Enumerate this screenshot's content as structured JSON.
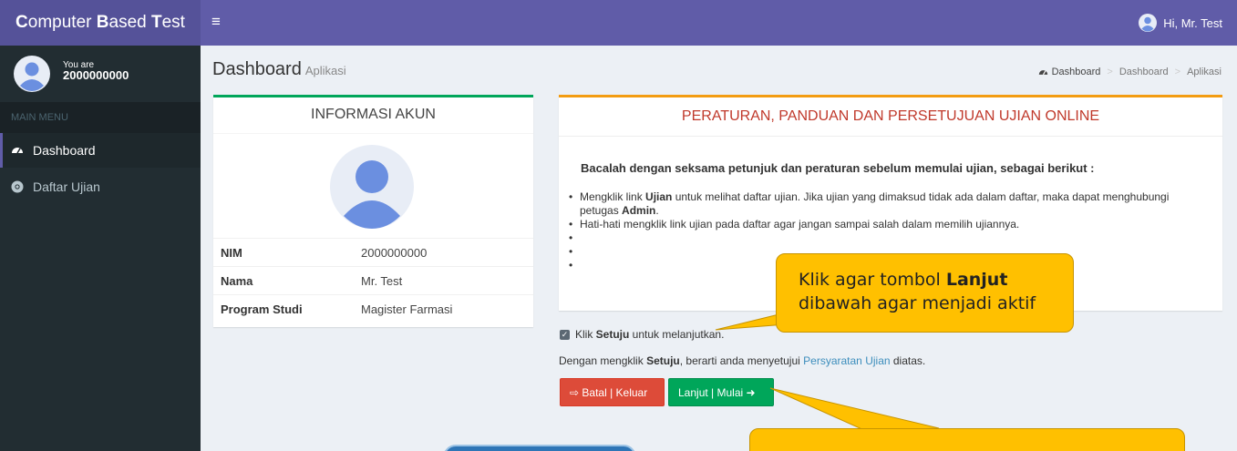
{
  "app": {
    "title_parts": [
      "C",
      "omputer ",
      "B",
      "ased ",
      "T",
      "est"
    ],
    "user_greeting": "Hi, Mr. Test"
  },
  "sidebar": {
    "you_are": "You are",
    "user_id": "2000000000",
    "menu_header": "MAIN MENU",
    "items": [
      {
        "label": "Dashboard",
        "icon": "dashboard-icon",
        "active": true
      },
      {
        "label": "Daftar Ujian",
        "icon": "chrome-icon",
        "active": false
      }
    ]
  },
  "page": {
    "title": "Dashboard",
    "subtitle": "Aplikasi",
    "breadcrumb": [
      "Dashboard",
      "Dashboard",
      "Aplikasi"
    ]
  },
  "account": {
    "header": "INFORMASI AKUN",
    "rows": [
      {
        "key": "NIM",
        "value": "2000000000"
      },
      {
        "key": "Nama",
        "value": "Mr. Test"
      },
      {
        "key": "Program Studi",
        "value": "Magister Farmasi"
      }
    ]
  },
  "rules": {
    "header": "PERATURAN, PANDUAN DAN PERSETUJUAN UJIAN ONLINE",
    "intro": "Bacalah dengan seksama petunjuk dan peraturan sebelum memulai ujian, sebagai berikut :",
    "item1": {
      "pre": "Mengklik link ",
      "bold1": "Ujian",
      "mid": " untuk melihat daftar ujian. Jika ujian yang dimaksud tidak ada dalam daftar, maka dapat menghubungi petugas ",
      "bold2": "Admin",
      "post": "."
    },
    "item2": "Hati-hati mengklik link ujian pada daftar agar jangan sampai salah dalam memilih ujiannya."
  },
  "agreement": {
    "checked": true,
    "pre": "Klik ",
    "bold": "Setuju",
    "post": " untuk melanjutkan.",
    "consent_pre": "Dengan mengklik ",
    "consent_bold": "Setuju",
    "consent_mid": ", berarti anda menyetujui ",
    "consent_link": "Persyaratan Ujian",
    "consent_post": " diatas."
  },
  "buttons": {
    "cancel": "Batal | Keluar",
    "next": "Lanjut | Mulai"
  },
  "callout": {
    "line1_pre": "Klik agar tombol ",
    "line1_bold": "Lanjut",
    "line2": "dibawah agar menjadi aktif"
  },
  "colors": {
    "header": "#605ca8",
    "logo_bg": "#555299",
    "sidebar": "#222d32",
    "danger": "#dd4b39",
    "success": "#00a65a",
    "callout": "#ffc000",
    "rules_title": "#c0392b"
  }
}
